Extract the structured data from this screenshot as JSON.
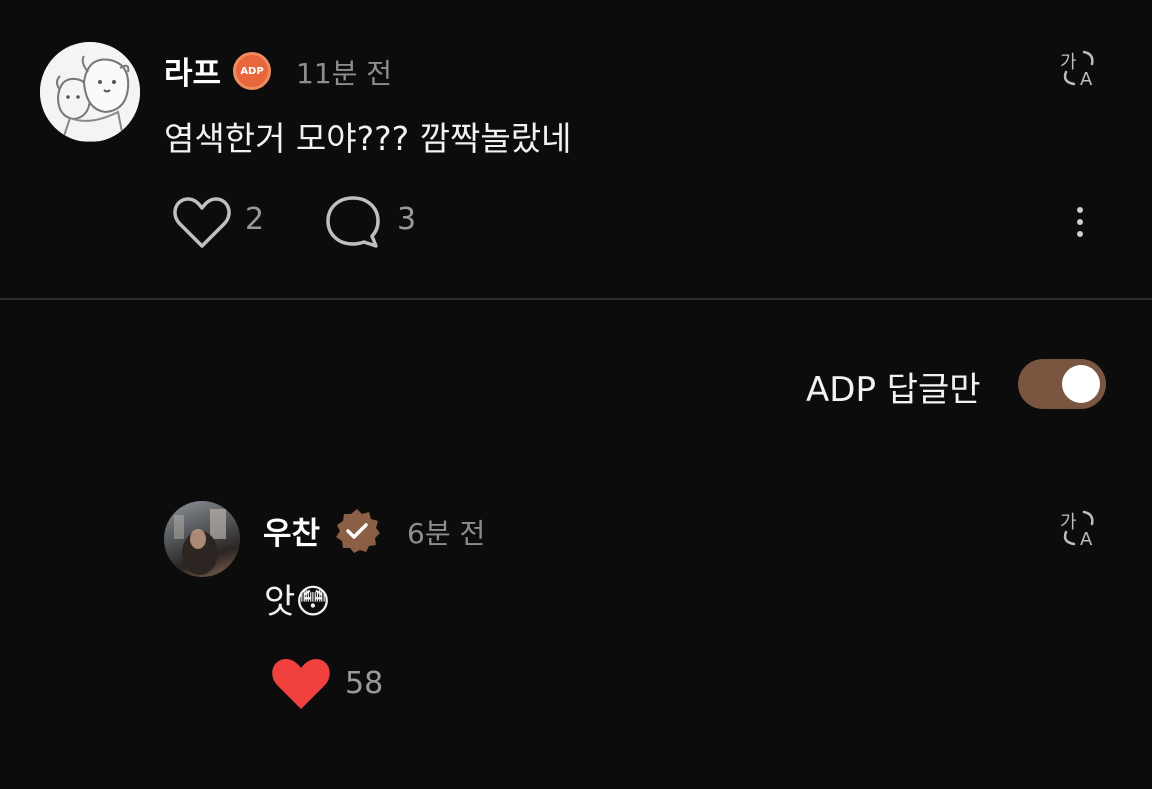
{
  "comment": {
    "author": "라프",
    "badge_text": "ADP",
    "time": "11분 전",
    "text": "염색한거 모야??? 깜짝놀랐네",
    "likes": "2",
    "replies": "3"
  },
  "filter": {
    "label": "ADP 답글만",
    "toggle_on": true
  },
  "reply": {
    "author": "우찬",
    "time": "6분 전",
    "text": "앗😳",
    "likes": "58",
    "liked": true
  },
  "colors": {
    "background": "#0d0c0c",
    "accent_toggle": "#7a5540",
    "badge_adp": "#e8663c",
    "verified_badge": "#8a5f45",
    "like_red": "#f0413f"
  },
  "icons": [
    "translate-icon",
    "heart-outline-icon",
    "speech-bubble-icon",
    "more-vertical-icon",
    "verified-icon",
    "heart-filled-icon"
  ]
}
